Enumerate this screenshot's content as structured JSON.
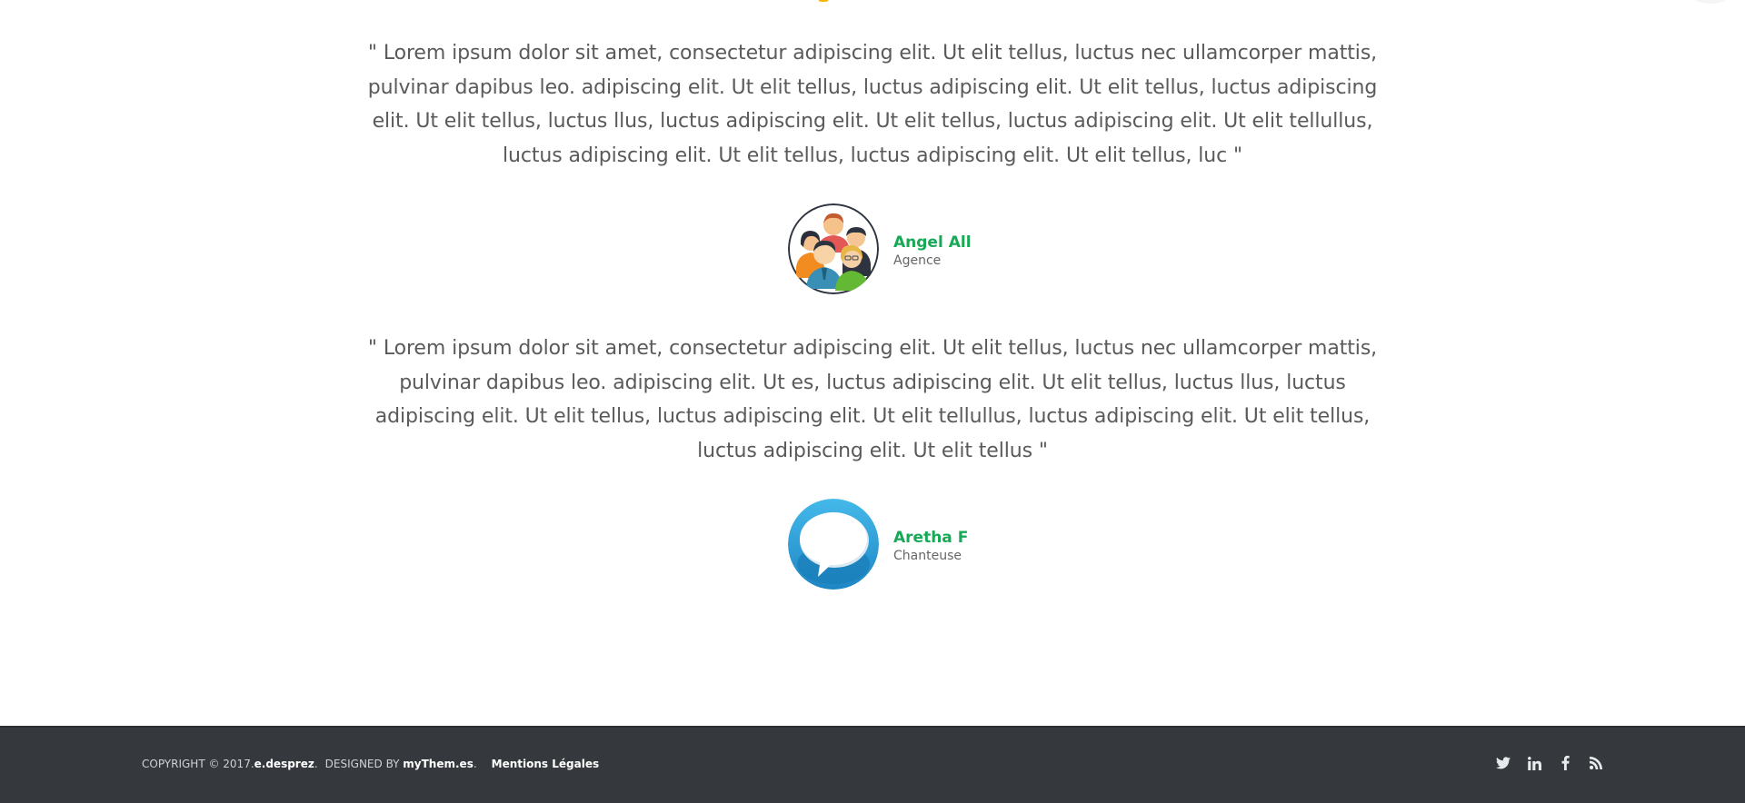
{
  "testimonials": [
    {
      "quote": "\" Lorem ipsum dolor sit amet, consectetur adipiscing elit. Ut elit tellus, luctus nec ullamcorper mattis, pulvinar dapibus leo. adipiscing elit. Ut elit tellus, luctus adipiscing elit. Ut elit tellus, luctus adipiscing elit. Ut elit tellus, luctus llus, luctus adipiscing elit. Ut elit tellus, luctus adipiscing elit. Ut elit tellullus, luctus adipiscing elit. Ut elit tellus, luctus adipiscing elit. Ut elit tellus, luc \"",
      "name": "Angel All",
      "role": "Agence",
      "avatar_icon": "group-people-icon"
    },
    {
      "quote": "\" Lorem ipsum dolor sit amet, consectetur adipiscing elit. Ut elit tellus, luctus nec ullamcorper mattis, pulvinar dapibus leo. adipiscing elit. Ut es, luctus adipiscing elit. Ut elit tellus, luctus llus, luctus adipiscing elit. Ut elit tellus, luctus adipiscing elit. Ut elit tellullus, luctus adipiscing elit. Ut elit tellus, luctus adipiscing elit. Ut elit tellus \"",
      "name": "Aretha F",
      "role": "Chanteuse",
      "avatar_icon": "speech-bubble-icon"
    }
  ],
  "footer": {
    "copyright_prefix": "COPYRIGHT © 2017.",
    "copyright_owner": "e.desprez",
    "copyright_suffix": ".",
    "designed_by_prefix": "DESIGNED BY",
    "designer": "myThem.es",
    "designer_suffix": ".",
    "legal_link": "Mentions Légales"
  },
  "social_icons": [
    "twitter-icon",
    "linkedin-icon",
    "facebook-icon",
    "rss-icon"
  ],
  "colors": {
    "accent_green": "#18a957",
    "footer_bg": "#35393d",
    "text_gray": "#5a5a5a"
  }
}
